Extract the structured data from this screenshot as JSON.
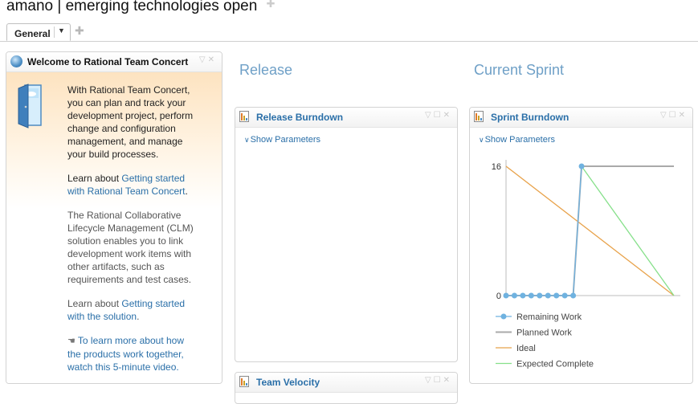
{
  "page": {
    "title": "amano | emerging technologies open"
  },
  "tabs": [
    {
      "label": "General"
    }
  ],
  "welcome": {
    "title": "Welcome to Rational Team Concert",
    "intro": [
      "With Rational Team Concert,",
      "you can plan and track your",
      "development project, perform",
      "change and configuration",
      "management, and manage",
      "your build processes."
    ],
    "learn1_prefix": "Learn about ",
    "learn1_link": [
      "Getting started",
      "with Rational Team Concert"
    ],
    "learn1_suffix": ".",
    "clm_text": [
      "The Rational Collaborative",
      "Lifecycle Management (CLM)",
      "solution enables you to link",
      "development work items with",
      "other artifacts, such as",
      "requirements and test cases."
    ],
    "learn2_prefix": "Learn about ",
    "learn2_link": [
      "Getting started",
      "with the solution"
    ],
    "learn2_suffix": ".",
    "video_link": [
      "To learn more about how",
      "the products work together,",
      "watch this 5-minute video."
    ]
  },
  "sections": {
    "release": "Release",
    "current_sprint": "Current Sprint"
  },
  "release_burndown": {
    "title": "Release Burndown",
    "show_parameters": "Show Parameters"
  },
  "team_velocity": {
    "title": "Team Velocity"
  },
  "sprint_burndown": {
    "title": "Sprint Burndown",
    "show_parameters": "Show Parameters",
    "chart_data": {
      "type": "line",
      "x": [
        1,
        2,
        3,
        4,
        5,
        6,
        7,
        8,
        9,
        10,
        11,
        12,
        13,
        14,
        15,
        16,
        17,
        18,
        19,
        20,
        21
      ],
      "ylim": [
        0,
        16
      ],
      "y_ticks": [
        "16",
        "0"
      ],
      "grid": false,
      "legend_position": "bottom",
      "series": [
        {
          "name": "Remaining Work",
          "color": "#6fb2e0",
          "marker": "circle",
          "values": [
            0,
            0,
            0,
            0,
            0,
            0,
            0,
            0,
            0,
            16
          ]
        },
        {
          "name": "Planned Work",
          "color": "#aaaaaa",
          "values": [
            0,
            0,
            0,
            0,
            0,
            0,
            0,
            0,
            0,
            16,
            16,
            16,
            16,
            16,
            16,
            16,
            16,
            16,
            16,
            16,
            16
          ]
        },
        {
          "name": "Ideal",
          "color": "#e8a24a",
          "points": [
            [
              1,
              16
            ],
            [
              21,
              0
            ]
          ]
        },
        {
          "name": "Expected Complete",
          "color": "#86e08a",
          "points": [
            [
              10,
              16
            ],
            [
              21,
              0
            ]
          ]
        }
      ]
    }
  }
}
